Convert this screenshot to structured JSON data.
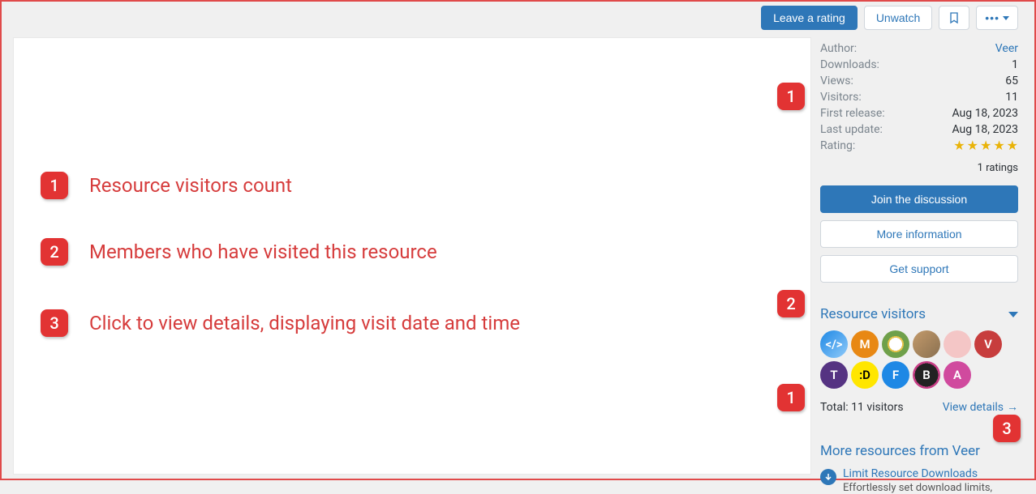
{
  "topbar": {
    "rate": "Leave a rating",
    "unwatch": "Unwatch"
  },
  "meta": {
    "author_label": "Author:",
    "author_value": "Veer",
    "downloads_label": "Downloads:",
    "downloads_value": "1",
    "views_label": "Views:",
    "views_value": "65",
    "visitors_label": "Visitors:",
    "visitors_value": "11",
    "first_release_label": "First release:",
    "first_release_value": "Aug 18, 2023",
    "last_update_label": "Last update:",
    "last_update_value": "Aug 18, 2023",
    "rating_label": "Rating:",
    "ratings_count": "1 ratings"
  },
  "sidebtns": {
    "discuss": "Join the discussion",
    "more_info": "More information",
    "support": "Get support"
  },
  "visitors_section": {
    "header": "Resource visitors",
    "avatars": [
      {
        "label": "</>",
        "cls": "av1"
      },
      {
        "label": "M",
        "cls": "av2"
      },
      {
        "label": "",
        "cls": "av3"
      },
      {
        "label": "",
        "cls": "av4"
      },
      {
        "label": "",
        "cls": "av5"
      },
      {
        "label": "V",
        "cls": "av6"
      },
      {
        "label": "T",
        "cls": "av7"
      },
      {
        "label": ":D",
        "cls": "av8"
      },
      {
        "label": "F",
        "cls": "av9"
      },
      {
        "label": "B",
        "cls": "av10"
      },
      {
        "label": "A",
        "cls": "av11"
      }
    ],
    "total": "Total: 11 visitors",
    "details": "View details"
  },
  "more_from": {
    "header": "More resources from Veer",
    "item_title": "Limit Resource Downloads",
    "item_desc": "Effortlessly set download limits,"
  },
  "annotations": {
    "a1": "Resource visitors count",
    "a2": "Members who have visited this resource",
    "a3": "Click to view details, displaying visit date and time"
  }
}
